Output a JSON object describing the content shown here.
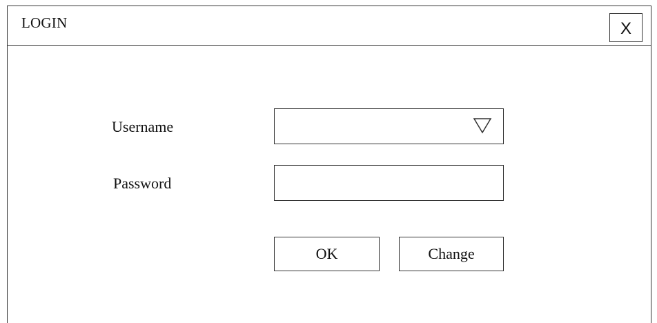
{
  "window": {
    "title": "LOGIN",
    "close_label": "X"
  },
  "form": {
    "username_label": "Username",
    "username_value": "",
    "username_icon": "triangle-down-outline",
    "password_label": "Password",
    "password_value": ""
  },
  "buttons": {
    "ok_label": "OK",
    "change_label": "Change"
  }
}
